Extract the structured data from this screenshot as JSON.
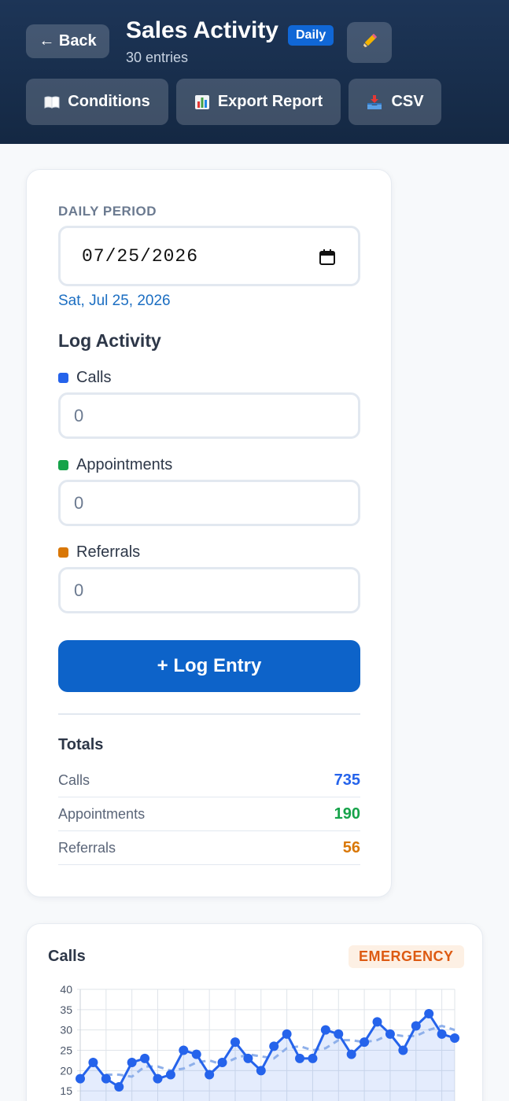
{
  "header": {
    "back_label": "← Back",
    "title": "Sales Activity",
    "badge": "Daily",
    "subtitle": "30 entries",
    "edit_icon": "pencil-icon",
    "buttons": [
      {
        "label": "Conditions",
        "icon": "book-icon"
      },
      {
        "label": "Export Report",
        "icon": "bar-chart-icon"
      },
      {
        "label": "CSV",
        "icon": "inbox-tray-icon"
      }
    ]
  },
  "form": {
    "period_label": "DAILY PERIOD",
    "date_value": "07/25/2026",
    "date_pretty": "Sat, Jul 25, 2026",
    "log_title": "Log Activity",
    "fields": [
      {
        "label": "Calls",
        "value": "0",
        "color": "#2563eb"
      },
      {
        "label": "Appointments",
        "value": "0",
        "color": "#16a34a"
      },
      {
        "label": "Referrals",
        "value": "0",
        "color": "#d97706"
      }
    ],
    "submit_label": "+ Log Entry"
  },
  "totals": {
    "title": "Totals",
    "rows": [
      {
        "label": "Calls",
        "value": "735",
        "color": "#2563eb"
      },
      {
        "label": "Appointments",
        "value": "190",
        "color": "#16a34a"
      },
      {
        "label": "Referrals",
        "value": "56",
        "color": "#d97706"
      }
    ]
  },
  "chart_card": {
    "title": "Calls",
    "status_badge": "EMERGENCY"
  },
  "chart_data": {
    "type": "line",
    "title": "Calls",
    "ylim": [
      10,
      40
    ],
    "yticks": [
      40,
      35,
      30,
      25,
      20,
      15
    ],
    "grid": true,
    "series": [
      {
        "values": [
          18,
          22,
          18,
          16,
          22,
          23,
          18,
          19,
          25,
          24,
          19,
          22,
          27,
          23,
          20,
          26,
          29,
          23,
          23,
          30,
          29,
          24,
          27,
          32,
          29,
          25,
          31,
          34,
          29,
          28
        ],
        "color": "#2563eb",
        "style": "solid"
      },
      {
        "values": [
          null,
          null,
          19,
          19,
          18.5,
          21,
          21,
          20,
          20.5,
          22,
          22.5,
          21.5,
          23,
          24,
          23.5,
          23,
          25.5,
          26,
          25,
          25.5,
          27.5,
          27.5,
          27,
          27.5,
          29,
          28.5,
          28.5,
          30,
          31,
          30
        ],
        "color": "#8fb0ea",
        "style": "dashed"
      }
    ]
  }
}
